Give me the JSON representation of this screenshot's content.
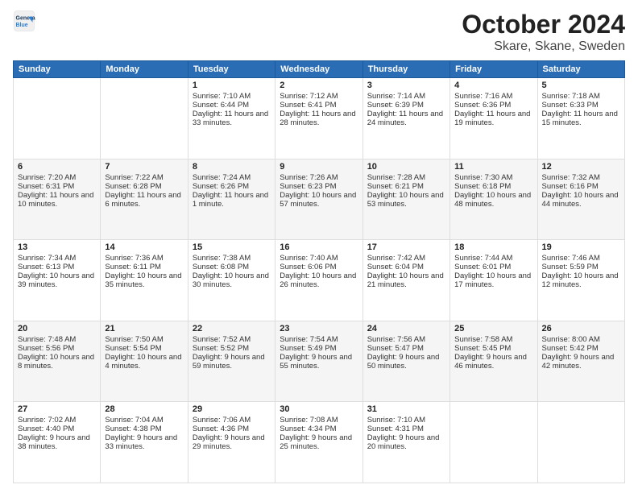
{
  "header": {
    "logo_line1": "General",
    "logo_line2": "Blue",
    "title": "October 2024",
    "subtitle": "Skare, Skane, Sweden"
  },
  "days_of_week": [
    "Sunday",
    "Monday",
    "Tuesday",
    "Wednesday",
    "Thursday",
    "Friday",
    "Saturday"
  ],
  "weeks": [
    [
      {
        "day": "",
        "sunrise": "",
        "sunset": "",
        "daylight": ""
      },
      {
        "day": "",
        "sunrise": "",
        "sunset": "",
        "daylight": ""
      },
      {
        "day": "1",
        "sunrise": "Sunrise: 7:10 AM",
        "sunset": "Sunset: 6:44 PM",
        "daylight": "Daylight: 11 hours and 33 minutes."
      },
      {
        "day": "2",
        "sunrise": "Sunrise: 7:12 AM",
        "sunset": "Sunset: 6:41 PM",
        "daylight": "Daylight: 11 hours and 28 minutes."
      },
      {
        "day": "3",
        "sunrise": "Sunrise: 7:14 AM",
        "sunset": "Sunset: 6:39 PM",
        "daylight": "Daylight: 11 hours and 24 minutes."
      },
      {
        "day": "4",
        "sunrise": "Sunrise: 7:16 AM",
        "sunset": "Sunset: 6:36 PM",
        "daylight": "Daylight: 11 hours and 19 minutes."
      },
      {
        "day": "5",
        "sunrise": "Sunrise: 7:18 AM",
        "sunset": "Sunset: 6:33 PM",
        "daylight": "Daylight: 11 hours and 15 minutes."
      }
    ],
    [
      {
        "day": "6",
        "sunrise": "Sunrise: 7:20 AM",
        "sunset": "Sunset: 6:31 PM",
        "daylight": "Daylight: 11 hours and 10 minutes."
      },
      {
        "day": "7",
        "sunrise": "Sunrise: 7:22 AM",
        "sunset": "Sunset: 6:28 PM",
        "daylight": "Daylight: 11 hours and 6 minutes."
      },
      {
        "day": "8",
        "sunrise": "Sunrise: 7:24 AM",
        "sunset": "Sunset: 6:26 PM",
        "daylight": "Daylight: 11 hours and 1 minute."
      },
      {
        "day": "9",
        "sunrise": "Sunrise: 7:26 AM",
        "sunset": "Sunset: 6:23 PM",
        "daylight": "Daylight: 10 hours and 57 minutes."
      },
      {
        "day": "10",
        "sunrise": "Sunrise: 7:28 AM",
        "sunset": "Sunset: 6:21 PM",
        "daylight": "Daylight: 10 hours and 53 minutes."
      },
      {
        "day": "11",
        "sunrise": "Sunrise: 7:30 AM",
        "sunset": "Sunset: 6:18 PM",
        "daylight": "Daylight: 10 hours and 48 minutes."
      },
      {
        "day": "12",
        "sunrise": "Sunrise: 7:32 AM",
        "sunset": "Sunset: 6:16 PM",
        "daylight": "Daylight: 10 hours and 44 minutes."
      }
    ],
    [
      {
        "day": "13",
        "sunrise": "Sunrise: 7:34 AM",
        "sunset": "Sunset: 6:13 PM",
        "daylight": "Daylight: 10 hours and 39 minutes."
      },
      {
        "day": "14",
        "sunrise": "Sunrise: 7:36 AM",
        "sunset": "Sunset: 6:11 PM",
        "daylight": "Daylight: 10 hours and 35 minutes."
      },
      {
        "day": "15",
        "sunrise": "Sunrise: 7:38 AM",
        "sunset": "Sunset: 6:08 PM",
        "daylight": "Daylight: 10 hours and 30 minutes."
      },
      {
        "day": "16",
        "sunrise": "Sunrise: 7:40 AM",
        "sunset": "Sunset: 6:06 PM",
        "daylight": "Daylight: 10 hours and 26 minutes."
      },
      {
        "day": "17",
        "sunrise": "Sunrise: 7:42 AM",
        "sunset": "Sunset: 6:04 PM",
        "daylight": "Daylight: 10 hours and 21 minutes."
      },
      {
        "day": "18",
        "sunrise": "Sunrise: 7:44 AM",
        "sunset": "Sunset: 6:01 PM",
        "daylight": "Daylight: 10 hours and 17 minutes."
      },
      {
        "day": "19",
        "sunrise": "Sunrise: 7:46 AM",
        "sunset": "Sunset: 5:59 PM",
        "daylight": "Daylight: 10 hours and 12 minutes."
      }
    ],
    [
      {
        "day": "20",
        "sunrise": "Sunrise: 7:48 AM",
        "sunset": "Sunset: 5:56 PM",
        "daylight": "Daylight: 10 hours and 8 minutes."
      },
      {
        "day": "21",
        "sunrise": "Sunrise: 7:50 AM",
        "sunset": "Sunset: 5:54 PM",
        "daylight": "Daylight: 10 hours and 4 minutes."
      },
      {
        "day": "22",
        "sunrise": "Sunrise: 7:52 AM",
        "sunset": "Sunset: 5:52 PM",
        "daylight": "Daylight: 9 hours and 59 minutes."
      },
      {
        "day": "23",
        "sunrise": "Sunrise: 7:54 AM",
        "sunset": "Sunset: 5:49 PM",
        "daylight": "Daylight: 9 hours and 55 minutes."
      },
      {
        "day": "24",
        "sunrise": "Sunrise: 7:56 AM",
        "sunset": "Sunset: 5:47 PM",
        "daylight": "Daylight: 9 hours and 50 minutes."
      },
      {
        "day": "25",
        "sunrise": "Sunrise: 7:58 AM",
        "sunset": "Sunset: 5:45 PM",
        "daylight": "Daylight: 9 hours and 46 minutes."
      },
      {
        "day": "26",
        "sunrise": "Sunrise: 8:00 AM",
        "sunset": "Sunset: 5:42 PM",
        "daylight": "Daylight: 9 hours and 42 minutes."
      }
    ],
    [
      {
        "day": "27",
        "sunrise": "Sunrise: 7:02 AM",
        "sunset": "Sunset: 4:40 PM",
        "daylight": "Daylight: 9 hours and 38 minutes."
      },
      {
        "day": "28",
        "sunrise": "Sunrise: 7:04 AM",
        "sunset": "Sunset: 4:38 PM",
        "daylight": "Daylight: 9 hours and 33 minutes."
      },
      {
        "day": "29",
        "sunrise": "Sunrise: 7:06 AM",
        "sunset": "Sunset: 4:36 PM",
        "daylight": "Daylight: 9 hours and 29 minutes."
      },
      {
        "day": "30",
        "sunrise": "Sunrise: 7:08 AM",
        "sunset": "Sunset: 4:34 PM",
        "daylight": "Daylight: 9 hours and 25 minutes."
      },
      {
        "day": "31",
        "sunrise": "Sunrise: 7:10 AM",
        "sunset": "Sunset: 4:31 PM",
        "daylight": "Daylight: 9 hours and 20 minutes."
      },
      {
        "day": "",
        "sunrise": "",
        "sunset": "",
        "daylight": ""
      },
      {
        "day": "",
        "sunrise": "",
        "sunset": "",
        "daylight": ""
      }
    ]
  ]
}
